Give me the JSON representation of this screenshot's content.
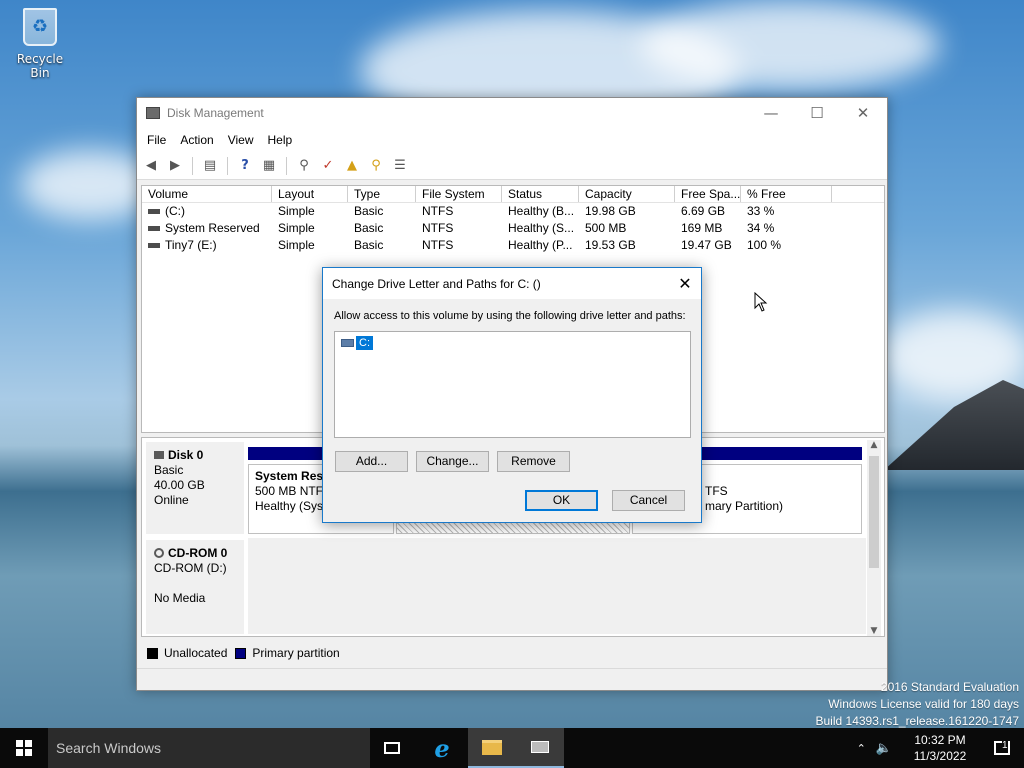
{
  "desktop": {
    "recycle_bin_label": "Recycle Bin",
    "watermark": [
      "2016 Standard Evaluation",
      "Windows License valid for 180 days",
      "Build 14393.rs1_release.161220-1747"
    ]
  },
  "window": {
    "title": "Disk Management",
    "minimize_icon": "minimize-icon",
    "maximize_icon": "maximize-icon",
    "close_icon": "close-icon"
  },
  "menu": {
    "items": [
      "File",
      "Action",
      "View",
      "Help"
    ]
  },
  "volumes": {
    "columns": [
      "Volume",
      "Layout",
      "Type",
      "File System",
      "Status",
      "Capacity",
      "Free Spa...",
      "% Free"
    ],
    "rows": [
      [
        "(C:)",
        "Simple",
        "Basic",
        "NTFS",
        "Healthy (B...",
        "19.98 GB",
        "6.69 GB",
        "33 %"
      ],
      [
        "System Reserved",
        "Simple",
        "Basic",
        "NTFS",
        "Healthy (S...",
        "500 MB",
        "169 MB",
        "34 %"
      ],
      [
        "Tiny7 (E:)",
        "Simple",
        "Basic",
        "NTFS",
        "Healthy (P...",
        "19.53 GB",
        "19.47 GB",
        "100 %"
      ]
    ]
  },
  "disks": {
    "disk0": {
      "name": "Disk 0",
      "type": "Basic",
      "size": "40.00 GB",
      "state": "Online",
      "partitions": {
        "system_reserved": {
          "name": "System Rese",
          "fs": "500 MB NTFS",
          "status": "Healthy (Syst"
        },
        "tiny7": {
          "fs": "TFS",
          "status": "mary Partition)"
        }
      }
    },
    "cdrom0": {
      "name": "CD-ROM 0",
      "type": "CD-ROM (D:)",
      "media": "No Media"
    }
  },
  "legend": {
    "unallocated": "Unallocated",
    "primary": "Primary partition",
    "unallocated_color": "#000000",
    "primary_color": "#000080"
  },
  "dialog": {
    "title": "Change Drive Letter and Paths for C: ()",
    "message": "Allow access to this volume by using the following drive letter and paths:",
    "list_items": [
      "C:"
    ],
    "add_label": "Add...",
    "change_label": "Change...",
    "remove_label": "Remove",
    "ok_label": "OK",
    "cancel_label": "Cancel"
  },
  "taskbar": {
    "search_placeholder": "Search Windows",
    "time": "10:32 PM",
    "date": "11/3/2022",
    "notification_count": "1"
  }
}
